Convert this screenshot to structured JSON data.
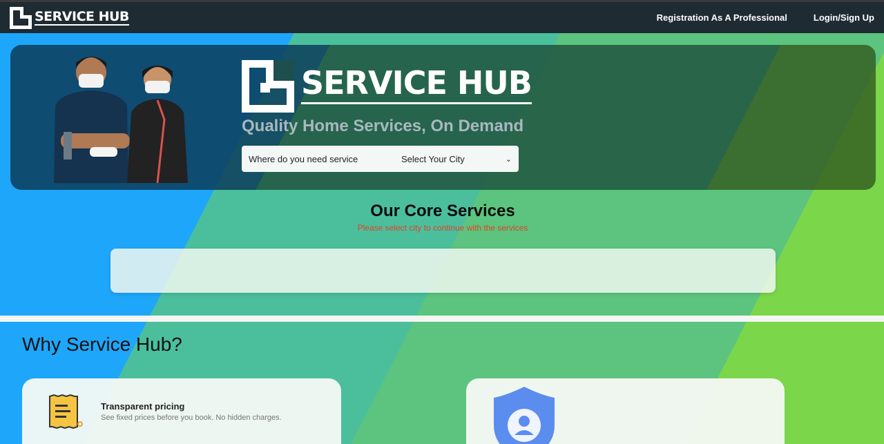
{
  "navbar": {
    "brand": "SERVICE HUB",
    "links": [
      "Registration As A Professional",
      "Login/Sign Up"
    ]
  },
  "hero": {
    "brand": "SERVICE HUB",
    "tagline": "Quality Home Services, On Demand",
    "search_label": "Where do you need service",
    "city_select": "Select Your City"
  },
  "core": {
    "title": "Our Core Services",
    "hint": "Please select city to continue with the services"
  },
  "why": {
    "title": "Why Service Hub?",
    "cards": [
      {
        "title": "Transparent pricing",
        "desc": "See fixed prices before you book. No hidden charges.",
        "icon": "receipt-icon"
      },
      {
        "icon": "shield-user-icon"
      }
    ]
  },
  "colors": {
    "navbar": "#1f2b33",
    "blue": "#1ea7fa",
    "green": "#7bd64a",
    "hint_red": "#e2402a"
  }
}
